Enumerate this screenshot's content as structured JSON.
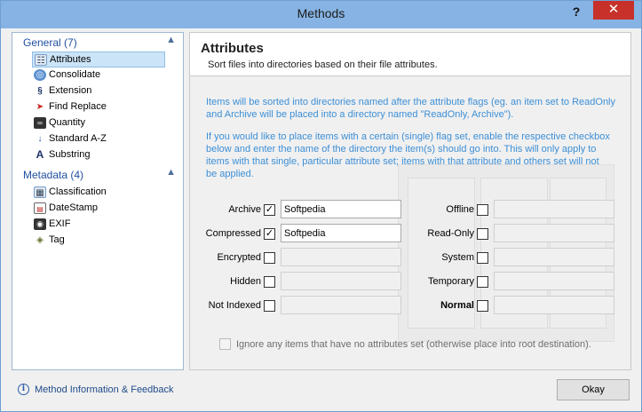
{
  "window": {
    "title": "Methods",
    "help_glyph": "?",
    "close_glyph": "✕"
  },
  "sidebar": {
    "groups": [
      {
        "label": "General (7)",
        "items": [
          {
            "label": "Attributes",
            "icon": "attributes-icon",
            "selected": true
          },
          {
            "label": "Consolidate",
            "icon": "consolidate-icon"
          },
          {
            "label": "Extension",
            "icon": "extension-icon"
          },
          {
            "label": "Find Replace",
            "icon": "find-replace-icon"
          },
          {
            "label": "Quantity",
            "icon": "quantity-icon"
          },
          {
            "label": "Standard A-Z",
            "icon": "sort-az-icon"
          },
          {
            "label": "Substring",
            "icon": "substring-icon"
          }
        ]
      },
      {
        "label": "Metadata (4)",
        "items": [
          {
            "label": "Classification",
            "icon": "classification-icon"
          },
          {
            "label": "DateStamp",
            "icon": "datestamp-icon"
          },
          {
            "label": "EXIF",
            "icon": "exif-icon"
          },
          {
            "label": "Tag",
            "icon": "tag-icon"
          }
        ]
      }
    ]
  },
  "main": {
    "title": "Attributes",
    "subtitle": "Sort files into directories based on their file attributes.",
    "info1_line1": "Items will be sorted into directories named after the attribute flags (eg. an item set to ReadOnly",
    "info1_line2": "and Archive will be placed into a directory named \"ReadOnly, Archive\").",
    "info2_line1": "If you would like to place items with a certain (single) flag set, enable the respective checkbox",
    "info2_line2": "below and enter the name of the directory the item(s) should go into. This will only apply to",
    "info2_line3": "items with that single, particular attribute set; items with that attribute and others set will not",
    "info2_line4": "be applied.",
    "left_attrs": [
      {
        "label": "Archive",
        "checked": true,
        "value": "Softpedia"
      },
      {
        "label": "Compressed",
        "checked": true,
        "value": "Softpedia"
      },
      {
        "label": "Encrypted",
        "checked": false,
        "value": ""
      },
      {
        "label": "Hidden",
        "checked": false,
        "value": ""
      },
      {
        "label": "Not Indexed",
        "checked": false,
        "value": ""
      }
    ],
    "right_attrs": [
      {
        "label": "Offline",
        "checked": false,
        "value": ""
      },
      {
        "label": "Read-Only",
        "checked": false,
        "value": ""
      },
      {
        "label": "System",
        "checked": false,
        "value": ""
      },
      {
        "label": "Temporary",
        "checked": false,
        "value": ""
      },
      {
        "label": "Normal",
        "checked": false,
        "value": "",
        "bold": true
      }
    ],
    "ignore_label": "Ignore any items that have no attributes set (otherwise place into root destination).",
    "ignore_checked": false
  },
  "footer": {
    "link_label": "Method Information & Feedback",
    "ok_label": "Okay"
  },
  "colors": {
    "titlebar": "#86b3e3",
    "close": "#c7312a",
    "info_text": "#3d8fd6",
    "group_label": "#1f4fa0",
    "selection": "#cce4f7"
  }
}
